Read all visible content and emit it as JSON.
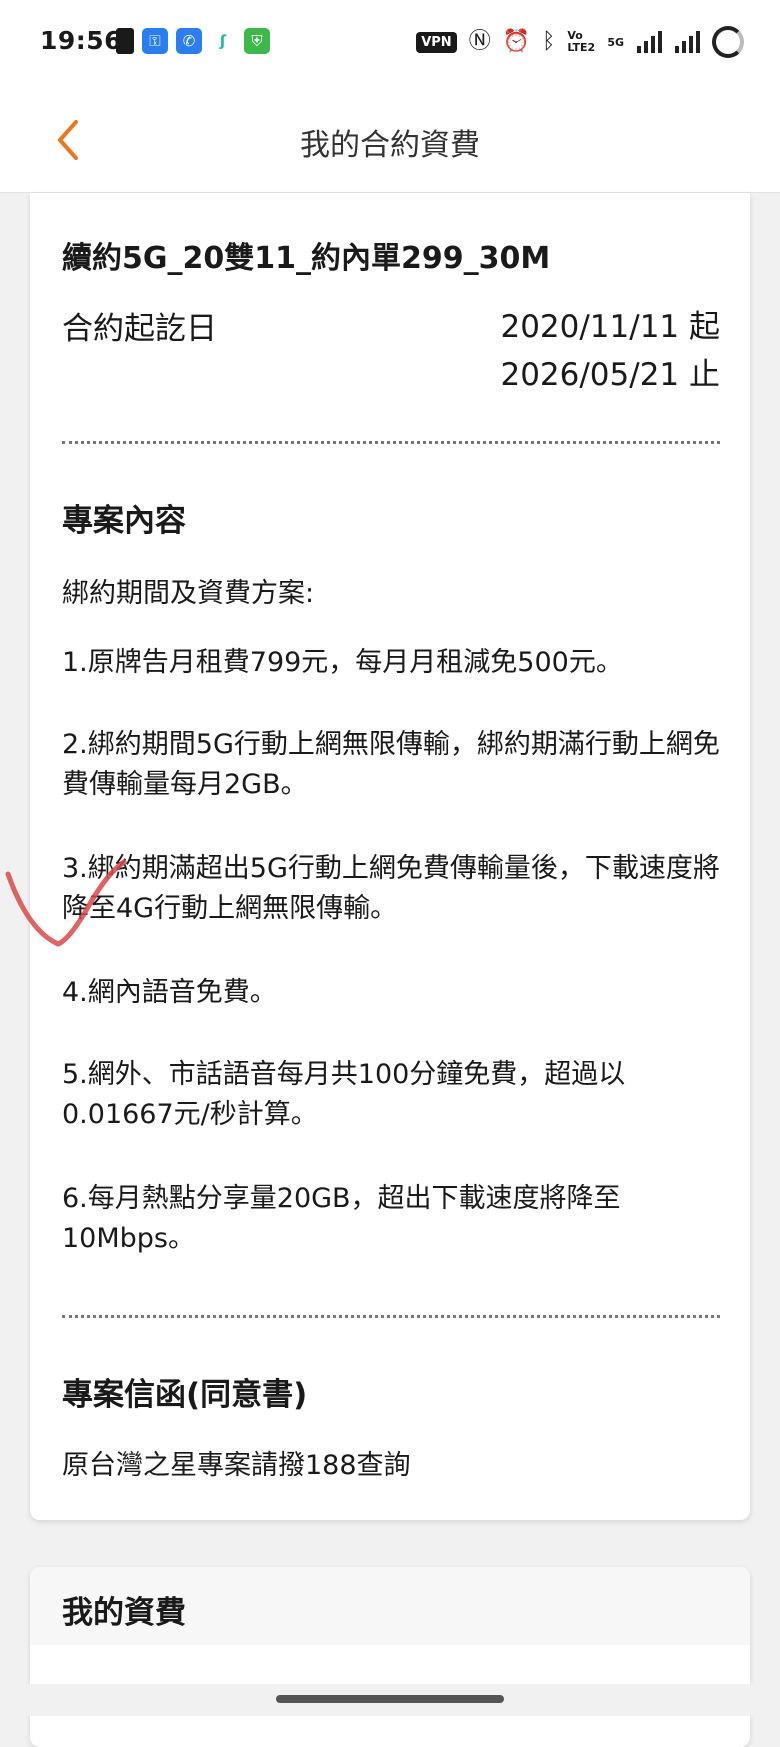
{
  "status_bar": {
    "time": "19:56",
    "vpn_label": "VPN",
    "network_label": "Vo LTE2",
    "signal_label": "5G",
    "notification_icons": [
      "sim-icon",
      "key-icon",
      "phone-app-icon",
      "s-app-icon",
      "shield-app-icon"
    ],
    "system_icons": [
      "nfc-icon",
      "alarm-icon",
      "bluetooth-icon",
      "signal-icon",
      "battery-ring-icon"
    ]
  },
  "header": {
    "title": "我的合約資費",
    "back_icon": "chevron-left-icon",
    "accent_color": "#e8771f"
  },
  "contract": {
    "plan_name": "續約5G_20雙11_約內單299_30M",
    "period_label": "合約起訖日",
    "start": "2020/11/11 起",
    "end": "2026/05/21 止"
  },
  "content": {
    "title": "專案內容",
    "intro": "綁約期間及資費方案:",
    "items": [
      "1.原牌告月租費799元，每月月租減免500元。",
      "2.綁約期間5G行動上網無限傳輸，綁約期滿行動上網免費傳輸量每月2GB。",
      "3.綁約期滿超出5G行動上網免費傳輸量後，下載速度將降至4G行動上網無限傳輸。",
      "4.網內語音免費。",
      "5.網外、市話語音每月共100分鐘免費，超過以0.01667元/秒計算。",
      "6.每月熱點分享量20GB，超出下載速度將降至10Mbps。"
    ]
  },
  "letter": {
    "title": "專案信函(同意書)",
    "text": "原台灣之星專案請撥188查詢"
  },
  "fees": {
    "title": "我的資費"
  },
  "annotation": {
    "mark": "check-mark",
    "color": "#d94a4a"
  }
}
